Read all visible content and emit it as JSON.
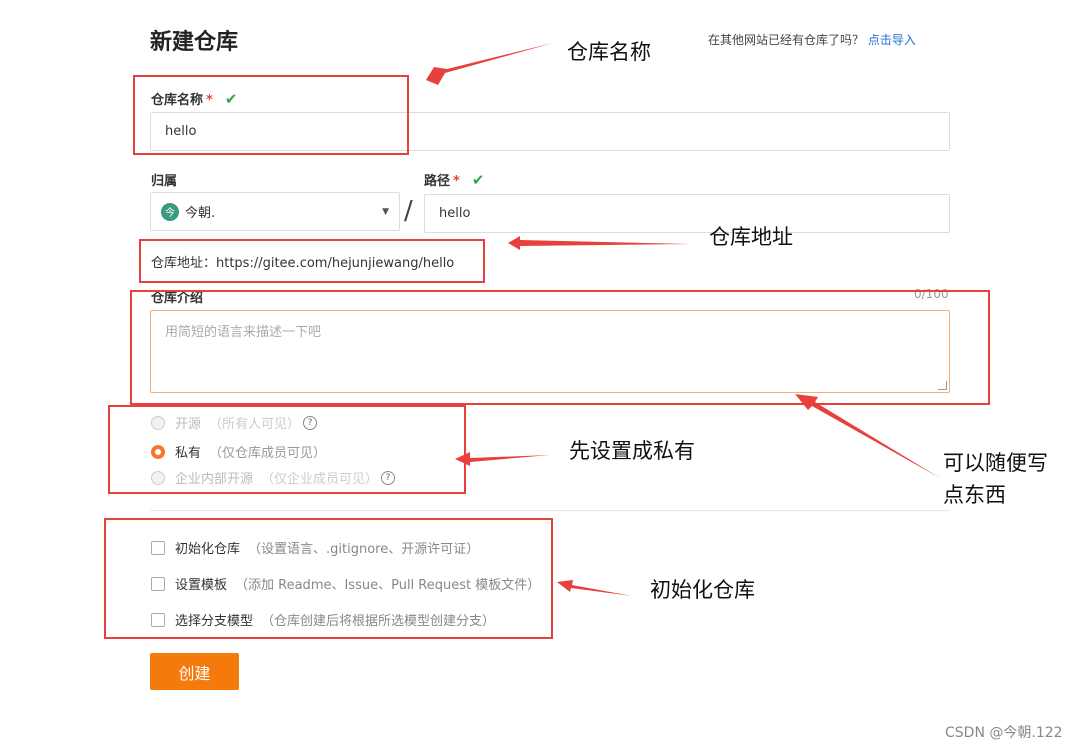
{
  "page": {
    "title": "新建仓库",
    "import_hint": "在其他网站已经有仓库了吗？",
    "import_link": "点击导入"
  },
  "form": {
    "repo_name_label": "仓库名称",
    "required_mark": "*",
    "repo_name_value": "hello",
    "owner_label": "归属",
    "owner_value": "今朝.",
    "owner_avatar_text": "今",
    "path_label": "路径",
    "path_value": "hello",
    "separator": "/",
    "address_text": "仓库地址：https://gitee.com/hejunjiewang/hello",
    "intro_label": "仓库介绍",
    "intro_counter": "0/100",
    "intro_placeholder": "用简短的语言来描述一下吧"
  },
  "visibility": {
    "options": [
      {
        "label": "开源",
        "hint": "（所有人可见）",
        "disabled": true,
        "checked": false
      },
      {
        "label": "私有",
        "hint": "（仅仓库成员可见）",
        "disabled": false,
        "checked": true
      },
      {
        "label": "企业内部开源",
        "hint": "（仅企业成员可见）",
        "disabled": true,
        "checked": false
      }
    ],
    "help_icon": "?"
  },
  "init_options": [
    {
      "label": "初始化仓库",
      "hint": "（设置语言、.gitignore、开源许可证）",
      "checked": false
    },
    {
      "label": "设置模板",
      "hint": "（添加 Readme、Issue、Pull Request 模板文件）",
      "checked": false
    },
    {
      "label": "选择分支模型",
      "hint": "（仓库创建后将根据所选模型创建分支）",
      "checked": false
    }
  ],
  "create_button": "创建",
  "annotations": {
    "repo_name": "仓库名称",
    "repo_address": "仓库地址",
    "set_private": "先设置成私有",
    "free_text_line1": "可以随便写",
    "free_text_line2": "点东西",
    "init_repo": "初始化仓库"
  },
  "watermark": "CSDN @今朝.122",
  "colors": {
    "accent": "#f57a0c",
    "annotation_red": "#e8413d",
    "check_green": "#2ea84a",
    "link_blue": "#1e6fd9"
  }
}
